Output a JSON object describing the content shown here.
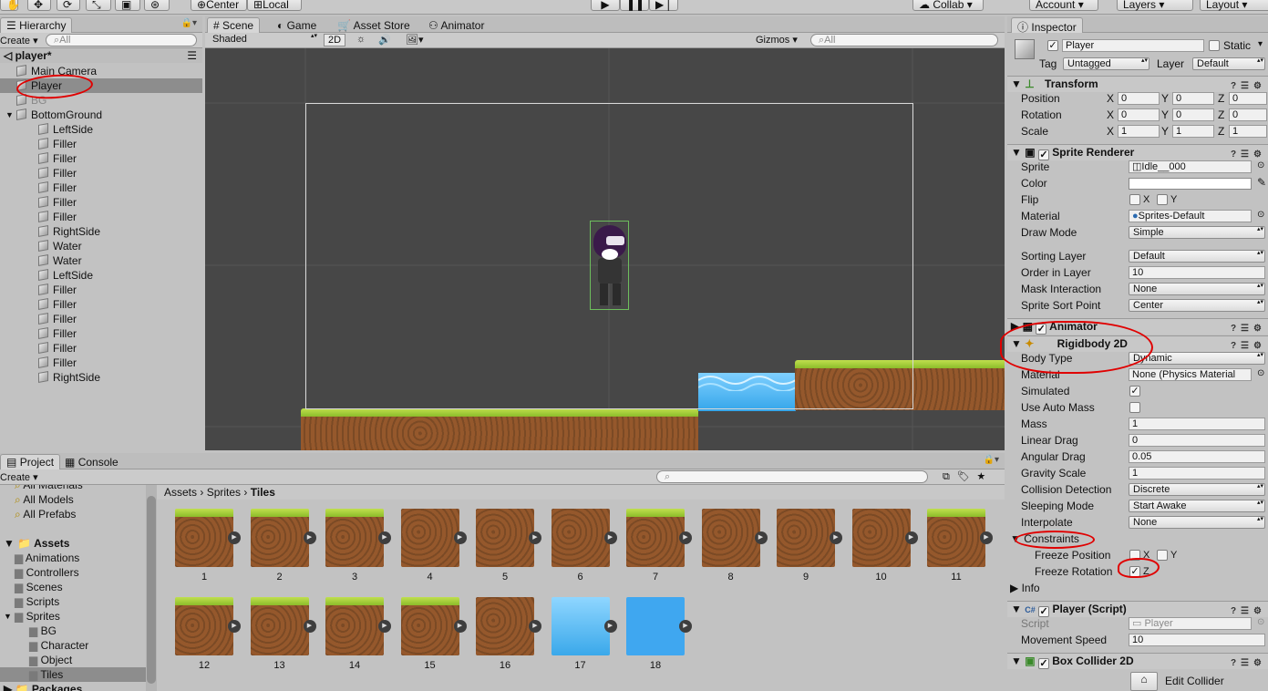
{
  "toolbar": {
    "center_label": "Center",
    "local_label": "Local",
    "collab_label": "Collab",
    "account_label": "Account",
    "layers_label": "Layers",
    "layout_label": "Layout"
  },
  "hierarchy": {
    "tab_label": "Hierarchy",
    "create_label": "Create",
    "search_placeholder": "All",
    "scene_name": "player*",
    "items": [
      {
        "label": "Main Camera",
        "depth": 1
      },
      {
        "label": "Player",
        "depth": 1,
        "selected": true
      },
      {
        "label": "BG",
        "depth": 1,
        "dim": true
      },
      {
        "label": "BottomGround",
        "depth": 1,
        "expanded": true
      },
      {
        "label": "LeftSide",
        "depth": 2
      },
      {
        "label": "Filler",
        "depth": 2
      },
      {
        "label": "Filler",
        "depth": 2
      },
      {
        "label": "Filler",
        "depth": 2
      },
      {
        "label": "Filler",
        "depth": 2
      },
      {
        "label": "Filler",
        "depth": 2
      },
      {
        "label": "Filler",
        "depth": 2
      },
      {
        "label": "RightSide",
        "depth": 2
      },
      {
        "label": "Water",
        "depth": 2
      },
      {
        "label": "Water",
        "depth": 2
      },
      {
        "label": "LeftSide",
        "depth": 2
      },
      {
        "label": "Filler",
        "depth": 2
      },
      {
        "label": "Filler",
        "depth": 2
      },
      {
        "label": "Filler",
        "depth": 2
      },
      {
        "label": "Filler",
        "depth": 2
      },
      {
        "label": "Filler",
        "depth": 2
      },
      {
        "label": "Filler",
        "depth": 2
      },
      {
        "label": "RightSide",
        "depth": 2
      }
    ]
  },
  "scene": {
    "tabs": [
      "Scene",
      "Game",
      "Asset Store",
      "Animator"
    ],
    "shading_mode": "Shaded",
    "mode_2d": "2D",
    "gizmos_label": "Gizmos",
    "search_placeholder": "All"
  },
  "project": {
    "tabs": [
      "Project",
      "Console"
    ],
    "create_label": "Create",
    "favorites": [
      "All Materials",
      "All Models",
      "All Prefabs"
    ],
    "assets_label": "Assets",
    "folders": [
      {
        "label": "Animations",
        "depth": 1
      },
      {
        "label": "Controllers",
        "depth": 1
      },
      {
        "label": "Scenes",
        "depth": 1
      },
      {
        "label": "Scripts",
        "depth": 1
      },
      {
        "label": "Sprites",
        "depth": 1,
        "expanded": true
      },
      {
        "label": "BG",
        "depth": 2
      },
      {
        "label": "Character",
        "depth": 2
      },
      {
        "label": "Object",
        "depth": 2
      },
      {
        "label": "Tiles",
        "depth": 2,
        "selected": true
      }
    ],
    "packages_label": "Packages",
    "breadcrumb": [
      "Assets",
      "Sprites",
      "Tiles"
    ],
    "tiles": [
      "1",
      "2",
      "3",
      "4",
      "5",
      "6",
      "7",
      "8",
      "9",
      "10",
      "11",
      "12",
      "13",
      "14",
      "15",
      "16",
      "17",
      "18"
    ]
  },
  "inspector": {
    "tab_label": "Inspector",
    "object_name": "Player",
    "static_label": "Static",
    "tag_label": "Tag",
    "tag_value": "Untagged",
    "layer_label": "Layer",
    "layer_value": "Default",
    "transform": {
      "title": "Transform",
      "position_label": "Position",
      "rotation_label": "Rotation",
      "scale_label": "Scale",
      "position": [
        "0",
        "0",
        "0"
      ],
      "rotation": [
        "0",
        "0",
        "0"
      ],
      "scale": [
        "1",
        "1",
        "1"
      ]
    },
    "sprite_renderer": {
      "title": "Sprite Renderer",
      "sprite_label": "Sprite",
      "sprite_value": "Idle__000",
      "color_label": "Color",
      "flip_label": "Flip",
      "material_label": "Material",
      "material_value": "Sprites-Default",
      "draw_mode_label": "Draw Mode",
      "draw_mode_value": "Simple",
      "sorting_layer_label": "Sorting Layer",
      "sorting_layer_value": "Default",
      "order_label": "Order in Layer",
      "order_value": "10",
      "mask_label": "Mask Interaction",
      "mask_value": "None",
      "sort_point_label": "Sprite Sort Point",
      "sort_point_value": "Center"
    },
    "animator_title": "Animator",
    "rigidbody": {
      "title": "Rigidbody 2D",
      "body_type_label": "Body Type",
      "body_type_value": "Dynamic",
      "material_label": "Material",
      "material_value": "None (Physics Material",
      "simulated_label": "Simulated",
      "auto_mass_label": "Use Auto Mass",
      "mass_label": "Mass",
      "mass_value": "1",
      "linear_drag_label": "Linear Drag",
      "linear_drag_value": "0",
      "angular_drag_label": "Angular Drag",
      "angular_drag_value": "0.05",
      "gravity_label": "Gravity Scale",
      "gravity_value": "1",
      "collision_label": "Collision Detection",
      "collision_value": "Discrete",
      "sleeping_label": "Sleeping Mode",
      "sleeping_value": "Start Awake",
      "interpolate_label": "Interpolate",
      "interpolate_value": "None",
      "constraints_label": "Constraints",
      "freeze_pos_label": "Freeze Position",
      "freeze_rot_label": "Freeze Rotation",
      "info_label": "Info"
    },
    "player_script": {
      "title": "Player (Script)",
      "script_label": "Script",
      "script_value": "Player",
      "speed_label": "Movement Speed",
      "speed_value": "10"
    },
    "box_collider": {
      "title": "Box Collider 2D",
      "edit_label": "Edit Collider"
    },
    "axis": {
      "x": "X",
      "y": "Y",
      "z": "Z"
    }
  }
}
